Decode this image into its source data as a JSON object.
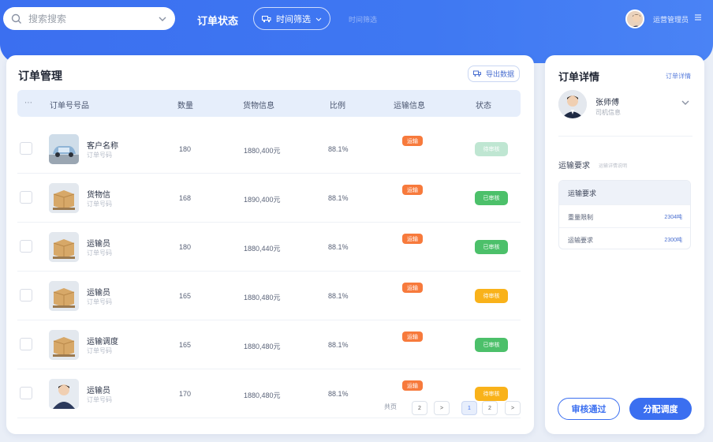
{
  "header": {
    "search_placeholder": "搜索搜索",
    "nav_title": "订单状态",
    "time_filter_label": "时间筛选",
    "nav_faint": "时间筛选",
    "user_name": "运营管理员"
  },
  "main": {
    "title": "订单管理",
    "export_label": "导出数据",
    "columns": [
      "订单号号品",
      "数量",
      "货物信息",
      "比例",
      "运输信息",
      "状态"
    ],
    "rows": [
      {
        "name": "客户名称",
        "sub": "订单号码",
        "qty": "180",
        "amount": "1880,400元",
        "pct": "88.1%",
        "tag": "运输",
        "status": "待审核",
        "status_color": "#bfe6d2",
        "thumb": "car"
      },
      {
        "name": "货物信",
        "sub": "订单号码",
        "qty": "168",
        "amount": "1890,400元",
        "pct": "88.1%",
        "tag": "运输",
        "status": "已审核",
        "status_color": "#4cc06a",
        "thumb": "box"
      },
      {
        "name": "运输员",
        "sub": "订单号码",
        "qty": "180",
        "amount": "1880,440元",
        "pct": "88.1%",
        "tag": "运输",
        "status": "已审核",
        "status_color": "#4cc06a",
        "thumb": "box"
      },
      {
        "name": "运输员",
        "sub": "订单号码",
        "qty": "165",
        "amount": "1880,480元",
        "pct": "88.1%",
        "tag": "运输",
        "status": "待审核",
        "status_color": "#f9b21a",
        "thumb": "box"
      },
      {
        "name": "运输调度",
        "sub": "订单号码",
        "qty": "165",
        "amount": "1880,480元",
        "pct": "88.1%",
        "tag": "运输",
        "status": "已审核",
        "status_color": "#4cc06a",
        "thumb": "box"
      },
      {
        "name": "运输员",
        "sub": "订单号码",
        "qty": "170",
        "amount": "1880,480元",
        "pct": "88.1%",
        "tag": "运输",
        "status": "待审核",
        "status_color": "#f9b21a",
        "thumb": "person"
      }
    ],
    "pager_label": "共页",
    "pager_buttons": [
      "2",
      ">",
      "1",
      "2",
      ">"
    ]
  },
  "side": {
    "title": "订单详情",
    "link_label": "订单详情",
    "driver_name": "张师傅",
    "driver_sub": "司机信息",
    "section_title": "运输要求",
    "section_sub": "运输详情说明",
    "req_head": "运输要求",
    "req_rows": [
      {
        "label": "重量限制",
        "value": "2304吨"
      },
      {
        "label": "运输要求",
        "value": "2300吨"
      }
    ],
    "approve_label": "审核通过",
    "dispatch_label": "分配调度"
  },
  "colors": {
    "accent": "#3b6ff0",
    "tag_orange": "#f77a3c",
    "status_green": "#4cc06a",
    "status_yellow": "#f9b21a"
  }
}
